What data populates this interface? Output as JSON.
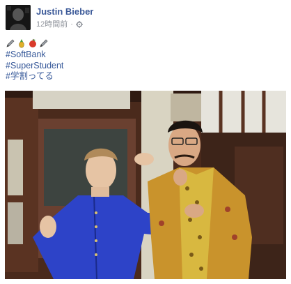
{
  "post": {
    "author": "Justin Bieber",
    "timestamp": "12時間前",
    "separator": "·",
    "privacy_icon": "gear-icon",
    "emojis": [
      "pen-icon",
      "pineapple-icon",
      "apple-icon",
      "pen-icon"
    ],
    "hashtags": [
      "#SoftBank",
      "#SuperStudent",
      "#学割ってる"
    ]
  },
  "colors": {
    "author": "#3b5998",
    "hashtag": "#365899",
    "meta": "#90949c",
    "text": "#1d2129"
  }
}
